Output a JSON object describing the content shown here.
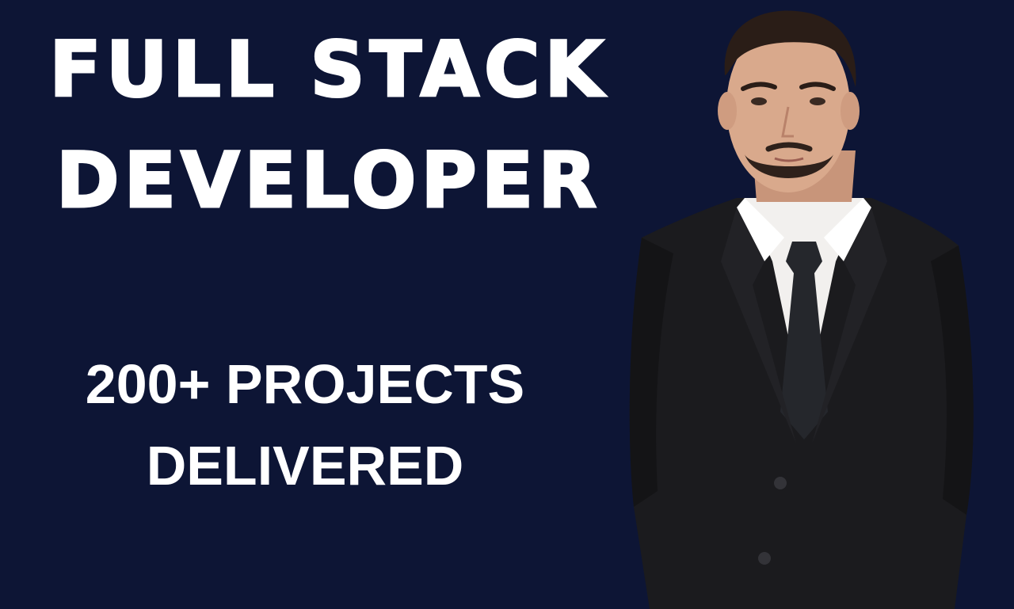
{
  "banner": {
    "headline_line1": "FULL STACK",
    "headline_line2": "DEVELOPER",
    "subline_line1": "200+ PROJECTS",
    "subline_line2": "DELIVERED"
  },
  "colors": {
    "background": "#0d1535",
    "text": "#ffffff",
    "suit": "#1b1b1e",
    "shirt": "#f2f0ee",
    "tie": "#25272c",
    "skin": "#d9a98c",
    "hair": "#2a1d17"
  },
  "photo": {
    "subject": "man in black suit with white shirt and dark tie"
  }
}
